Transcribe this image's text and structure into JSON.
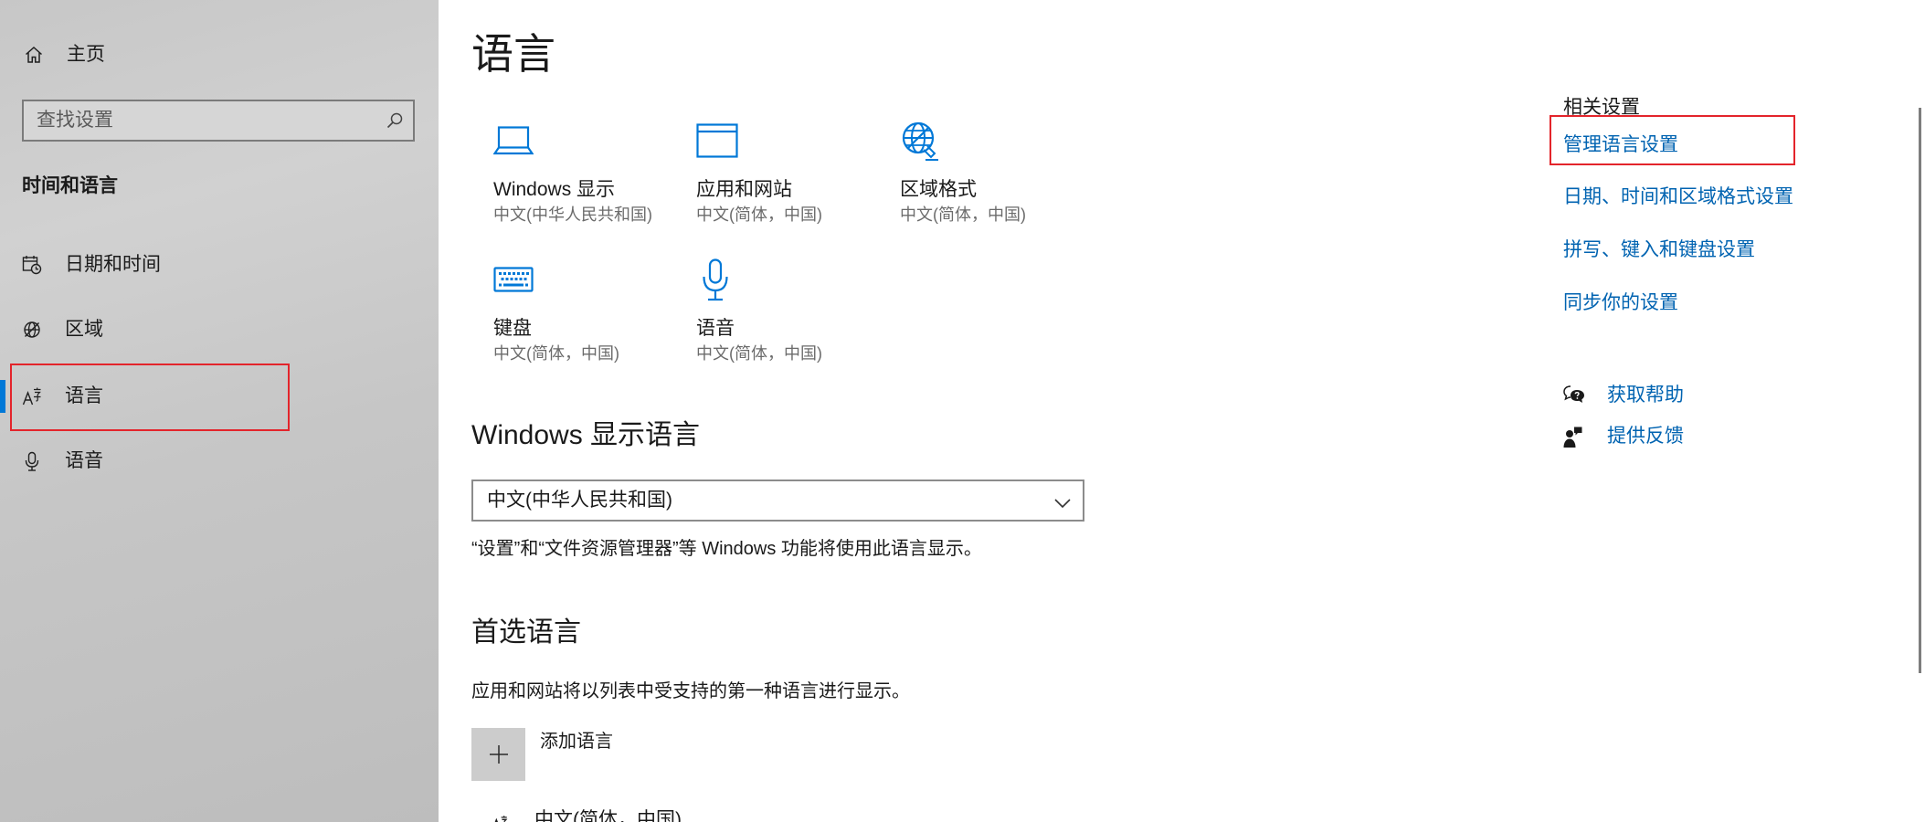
{
  "sidebar": {
    "home_label": "主页",
    "home_icon": "home-icon",
    "search_placeholder": "查找设置",
    "search_icon": "search-icon",
    "section_title": "时间和语言",
    "items": [
      {
        "label": "日期和时间",
        "icon": "calendar-clock-icon",
        "selected": false
      },
      {
        "label": "区域",
        "icon": "region-globe-icon",
        "selected": false
      },
      {
        "label": "语言",
        "icon": "language-icon",
        "selected": true
      },
      {
        "label": "语音",
        "icon": "microphone-icon",
        "selected": false
      }
    ]
  },
  "main": {
    "title": "语言",
    "tiles": [
      {
        "label": "Windows 显示",
        "sub": "中文(中华人民共和国)",
        "icon": "laptop-icon"
      },
      {
        "label": "应用和网站",
        "sub": "中文(简体，中国)",
        "icon": "app-window-icon"
      },
      {
        "label": "区域格式",
        "sub": "中文(简体，中国)",
        "icon": "region-format-globe-icon"
      },
      {
        "label": "键盘",
        "sub": "中文(简体，中国)",
        "icon": "keyboard-icon"
      },
      {
        "label": "语音",
        "sub": "中文(简体，中国)",
        "icon": "microphone-icon"
      }
    ],
    "display_language": {
      "heading": "Windows 显示语言",
      "selected": "中文(中华人民共和国)",
      "description": "“设置”和“文件资源管理器”等 Windows 功能将使用此语言显示。"
    },
    "preferred_languages": {
      "heading": "首选语言",
      "description": "应用和网站将以列表中受支持的第一种语言进行显示。",
      "add_label": "添加语言",
      "add_icon": "plus-icon",
      "items": [
        {
          "label": "中文(简体，中国)",
          "icon": "language-icon"
        }
      ]
    }
  },
  "related_settings": {
    "heading": "相关设置",
    "links": [
      {
        "label": "管理语言设置"
      },
      {
        "label": "日期、时间和区域格式设置"
      },
      {
        "label": "拼写、键入和键盘设置"
      },
      {
        "label": "同步你的设置"
      }
    ],
    "help": {
      "label": "获取帮助",
      "icon": "help-chat-icon"
    },
    "feedback": {
      "label": "提供反馈",
      "icon": "feedback-icon"
    }
  },
  "colors": {
    "accent": "#0078d7",
    "link": "#0063b1",
    "annotation_box": "#e3242b",
    "sidebar_background": "#c6c6c6",
    "add_button_background": "#cccccc"
  }
}
